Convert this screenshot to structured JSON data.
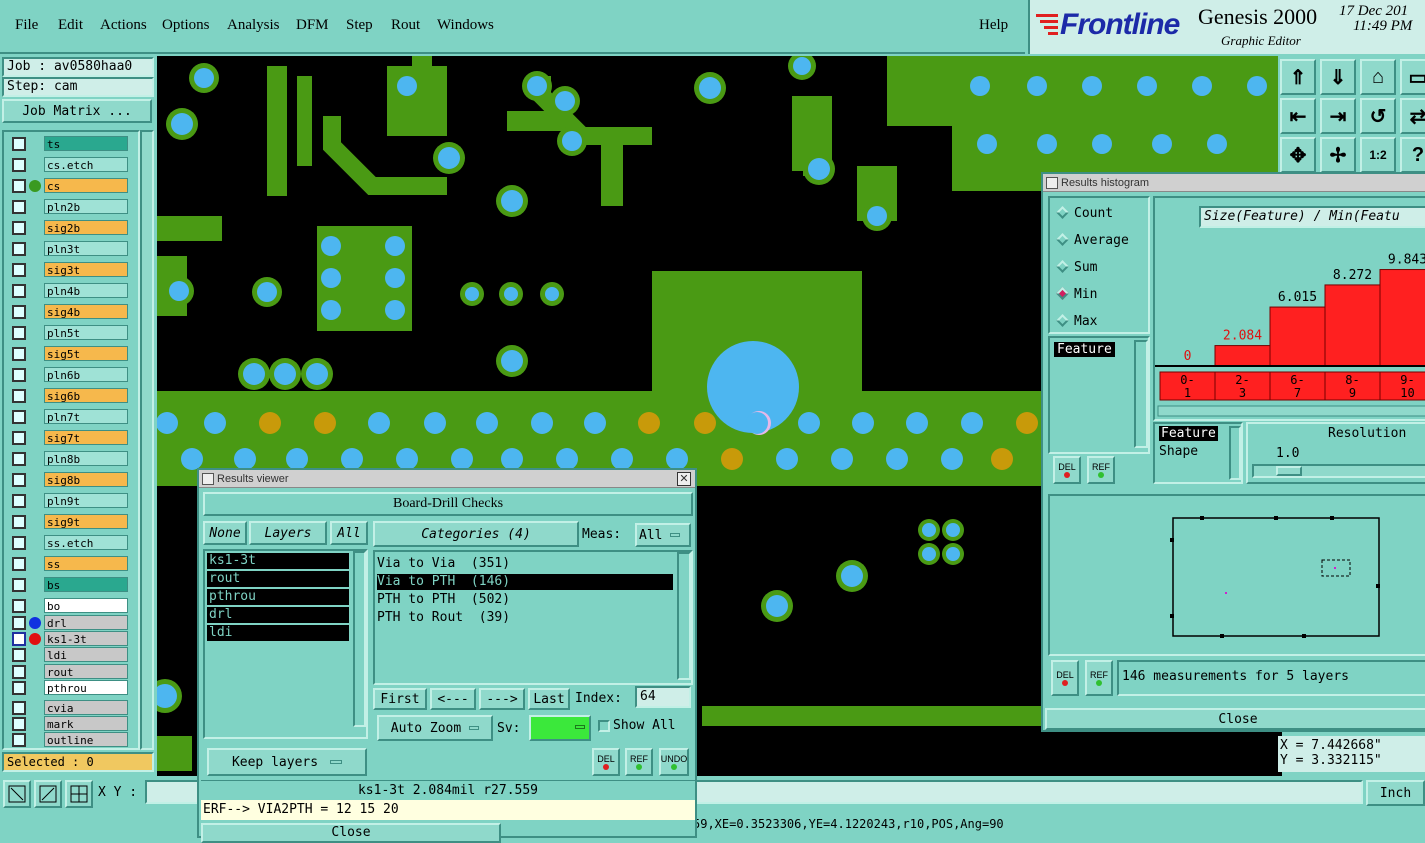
{
  "menubar": {
    "items": [
      "File",
      "Edit",
      "Actions",
      "Options",
      "Analysis",
      "DFM",
      "Step",
      "Rout",
      "Windows"
    ],
    "help": "Help"
  },
  "brand": {
    "logo": "Frontline",
    "product": "Genesis 2000",
    "subtitle": "Graphic Editor",
    "date": "17 Dec 201",
    "time": "11:49 PM"
  },
  "job": {
    "job_label": "Job : av0580haa0",
    "step_label": "Step: cam",
    "matrix_button": "Job Matrix ..."
  },
  "layers": [
    {
      "name": "ts",
      "color": "#2aa88f"
    },
    {
      "name": "cs.etch",
      "color": "#9fe2d6"
    },
    {
      "name": "cs",
      "color": "#f6b84c",
      "dot": "#3a9a20"
    },
    {
      "name": "pln2b",
      "color": "#9fe2d6"
    },
    {
      "name": "sig2b",
      "color": "#f6b84c"
    },
    {
      "name": "pln3t",
      "color": "#9fe2d6"
    },
    {
      "name": "sig3t",
      "color": "#f6b84c"
    },
    {
      "name": "pln4b",
      "color": "#9fe2d6"
    },
    {
      "name": "sig4b",
      "color": "#f6b84c"
    },
    {
      "name": "pln5t",
      "color": "#9fe2d6"
    },
    {
      "name": "sig5t",
      "color": "#f6b84c"
    },
    {
      "name": "pln6b",
      "color": "#9fe2d6"
    },
    {
      "name": "sig6b",
      "color": "#f6b84c"
    },
    {
      "name": "pln7t",
      "color": "#9fe2d6"
    },
    {
      "name": "sig7t",
      "color": "#f6b84c"
    },
    {
      "name": "pln8b",
      "color": "#9fe2d6"
    },
    {
      "name": "sig8b",
      "color": "#f6b84c"
    },
    {
      "name": "pln9t",
      "color": "#9fe2d6"
    },
    {
      "name": "sig9t",
      "color": "#f6b84c"
    },
    {
      "name": "ss.etch",
      "color": "#9fe2d6"
    },
    {
      "name": "ss",
      "color": "#f6b84c"
    },
    {
      "name": "bs",
      "color": "#2aa88f"
    },
    {
      "name": "bo",
      "color": "#ffffff"
    },
    {
      "name": "drl",
      "color": "#c8c8c8",
      "dot": "#1030e0"
    },
    {
      "name": "ks1-3t",
      "color": "#c8c8c8",
      "dot": "#e01010",
      "active": true
    },
    {
      "name": "ldi",
      "color": "#c8c8c8"
    },
    {
      "name": "rout",
      "color": "#c8c8c8"
    },
    {
      "name": "pthrou",
      "color": "#ffffff"
    },
    {
      "name": "cvia",
      "color": "#c8c8c8"
    },
    {
      "name": "mark",
      "color": "#c8c8c8"
    },
    {
      "name": "outline",
      "color": "#c8c8c8"
    }
  ],
  "status": {
    "selected": "Selected : 0",
    "xy_label": "X Y :",
    "coords_text": "59,XE=0.3523306,YE=4.1220243,r10,POS,Ang=90",
    "x_readout": "X = 7.442668\"",
    "y_readout": "Y = 3.332115\"",
    "units": "Inch"
  },
  "results_viewer": {
    "title": "Results viewer",
    "header": "Board-Drill Checks",
    "none_btn": "None",
    "layers_btn": "Layers",
    "all_btn": "All",
    "categories_btn": "Categories (4)",
    "meas_label": "Meas:",
    "meas_value": "All",
    "layer_list": [
      "ks1-3t",
      "rout",
      "pthrou",
      "drl",
      "ldi"
    ],
    "categories": [
      {
        "label": "Via to Via  (351)",
        "selected": false
      },
      {
        "label": "Via to PTH  (146)",
        "selected": true
      },
      {
        "label": "PTH to PTH  (502)",
        "selected": false
      },
      {
        "label": "PTH to Rout  (39)",
        "selected": false
      }
    ],
    "first": "First",
    "prev": "<---",
    "next": "--->",
    "last": "Last",
    "index_label": "Index:",
    "index_value": "64",
    "auto_zoom": "Auto Zoom",
    "sv_label": "Sv:",
    "show_all": "Show All",
    "keep_layers": "Keep layers",
    "del": "DEL",
    "ref": "REF",
    "undo": "UNDO",
    "measure_line": "ks1-3t 2.084mil  r27.559",
    "erf_line": "ERF--> VIA2PTH = 12 15 20",
    "close": "Close"
  },
  "histogram": {
    "title": "Results histogram",
    "modes": [
      {
        "label": "Count",
        "selected": false
      },
      {
        "label": "Average",
        "selected": false
      },
      {
        "label": "Sum",
        "selected": false
      },
      {
        "label": "Min",
        "selected": true
      },
      {
        "label": "Max",
        "selected": false
      }
    ],
    "feature_sel": "Feature",
    "chart_title": "Size(Feature) / Min(Featu",
    "bars": [
      {
        "range_top": "0-",
        "range_bottom": "1",
        "value": 0,
        "label": "0"
      },
      {
        "range_top": "2-",
        "range_bottom": "3",
        "value": 2.084,
        "label": "2.084"
      },
      {
        "range_top": "6-",
        "range_bottom": "7",
        "value": 6.015,
        "label": "6.015"
      },
      {
        "range_top": "8-",
        "range_bottom": "9",
        "value": 8.272,
        "label": "8.272"
      },
      {
        "range_top": "9-",
        "range_bottom": "10",
        "value": 9.843,
        "label": "9.843"
      }
    ],
    "group_list": [
      "Feature",
      "Shape"
    ],
    "resolution_label": "Resolution",
    "resolution_value": "1.0",
    "del": "DEL",
    "ref": "REF",
    "measurements_text": "146 measurements for 5 layers",
    "close": "Close"
  },
  "toolbar_icons": [
    "layer-up-icon",
    "layer-down-icon",
    "home-icon",
    "window-icon",
    "pan-left-icon",
    "pan-right-icon",
    "undo-zoom-icon",
    "toggle-icon",
    "zoom-fit-icon",
    "zoom-center-icon",
    "scale-1-2-icon",
    "help-icon"
  ]
}
